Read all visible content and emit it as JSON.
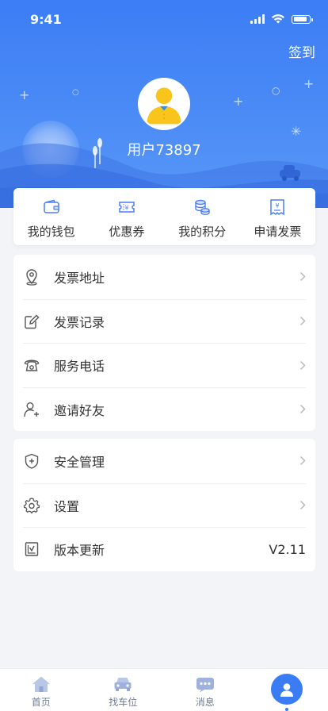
{
  "status_bar": {
    "time": "9:41"
  },
  "header": {
    "checkin_label": "签到",
    "username": "用户73897"
  },
  "quick_actions": [
    {
      "label": "我的钱包",
      "icon": "wallet-icon"
    },
    {
      "label": "优惠券",
      "icon": "coupon-icon"
    },
    {
      "label": "我的积分",
      "icon": "points-icon"
    },
    {
      "label": "申请发票",
      "icon": "invoice-icon"
    }
  ],
  "menu_group_1": [
    {
      "label": "发票地址",
      "icon": "location-pin-icon"
    },
    {
      "label": "发票记录",
      "icon": "edit-icon"
    },
    {
      "label": "服务电话",
      "icon": "phone-icon"
    },
    {
      "label": "邀请好友",
      "icon": "add-user-icon"
    }
  ],
  "menu_group_2": [
    {
      "label": "安全管理",
      "icon": "shield-icon"
    },
    {
      "label": "设置",
      "icon": "gear-icon"
    },
    {
      "label": "版本更新",
      "icon": "update-icon",
      "value": "V2.11"
    }
  ],
  "tabbar": [
    {
      "label": "首页",
      "icon": "home-icon"
    },
    {
      "label": "找车位",
      "icon": "car-icon"
    },
    {
      "label": "消息",
      "icon": "message-icon"
    },
    {
      "label": "",
      "icon": "user-icon",
      "active": true
    }
  ],
  "colors": {
    "primary": "#3a7cf4",
    "header_top": "#3d7df5",
    "avatar_yellow": "#f9c51c",
    "background": "#f3f4f8"
  }
}
